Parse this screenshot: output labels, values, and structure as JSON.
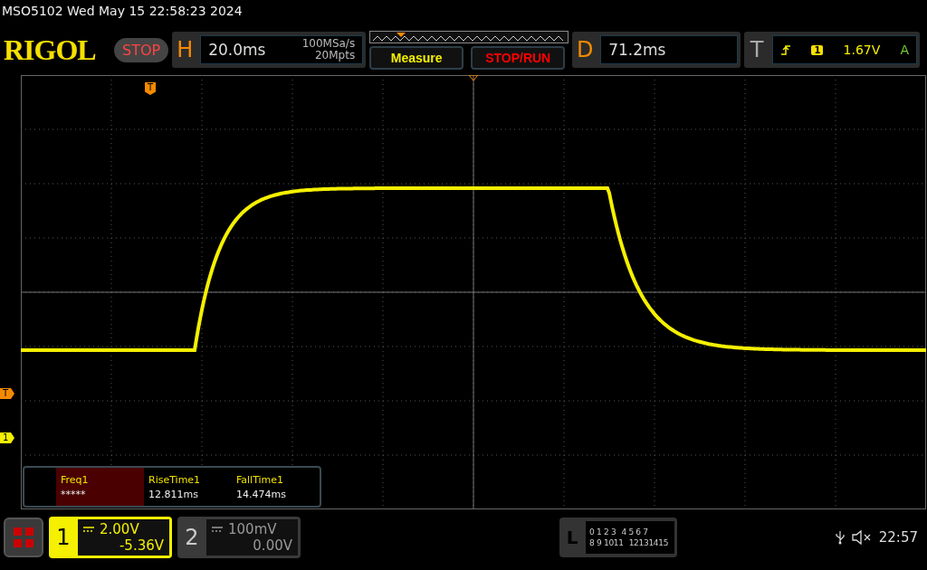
{
  "status_line": "MSO5102  Wed May 15 22:58:23 2024",
  "header": {
    "logo": "RIGOL",
    "run_state": "STOP",
    "horizontal": {
      "letter": "H",
      "timebase": "20.0ms",
      "sample_rate": "100MSa/s",
      "memory_depth": "20Mpts"
    },
    "buttons": [
      {
        "label": "Measure",
        "kind": "measure"
      },
      {
        "label": "STOP/RUN",
        "kind": "stoprun"
      }
    ],
    "delay": {
      "letter": "D",
      "value": "71.2ms"
    },
    "trigger": {
      "letter": "T",
      "source": "1",
      "level": "1.67V",
      "mode": "A"
    }
  },
  "markers": {
    "trigger_position": "T",
    "trigger_level": "T",
    "channel": "1"
  },
  "measurements": [
    {
      "label": "Freq1",
      "value": "*****",
      "selected": true
    },
    {
      "label": "RiseTime1",
      "value": "12.811ms",
      "selected": false
    },
    {
      "label": "FallTime1",
      "value": "14.474ms",
      "selected": false
    }
  ],
  "channels": [
    {
      "number": "1",
      "scale": "2.00V",
      "offset": "-5.36V",
      "selected": true
    },
    {
      "number": "2",
      "scale": "100mV",
      "offset": "0.00V",
      "selected": false
    }
  ],
  "logic": {
    "letter": "L",
    "rows": [
      [
        "0 1 2 3",
        "4 5 6 7"
      ],
      [
        "8 9 1011",
        "12131415"
      ]
    ]
  },
  "clock": "22:57"
}
